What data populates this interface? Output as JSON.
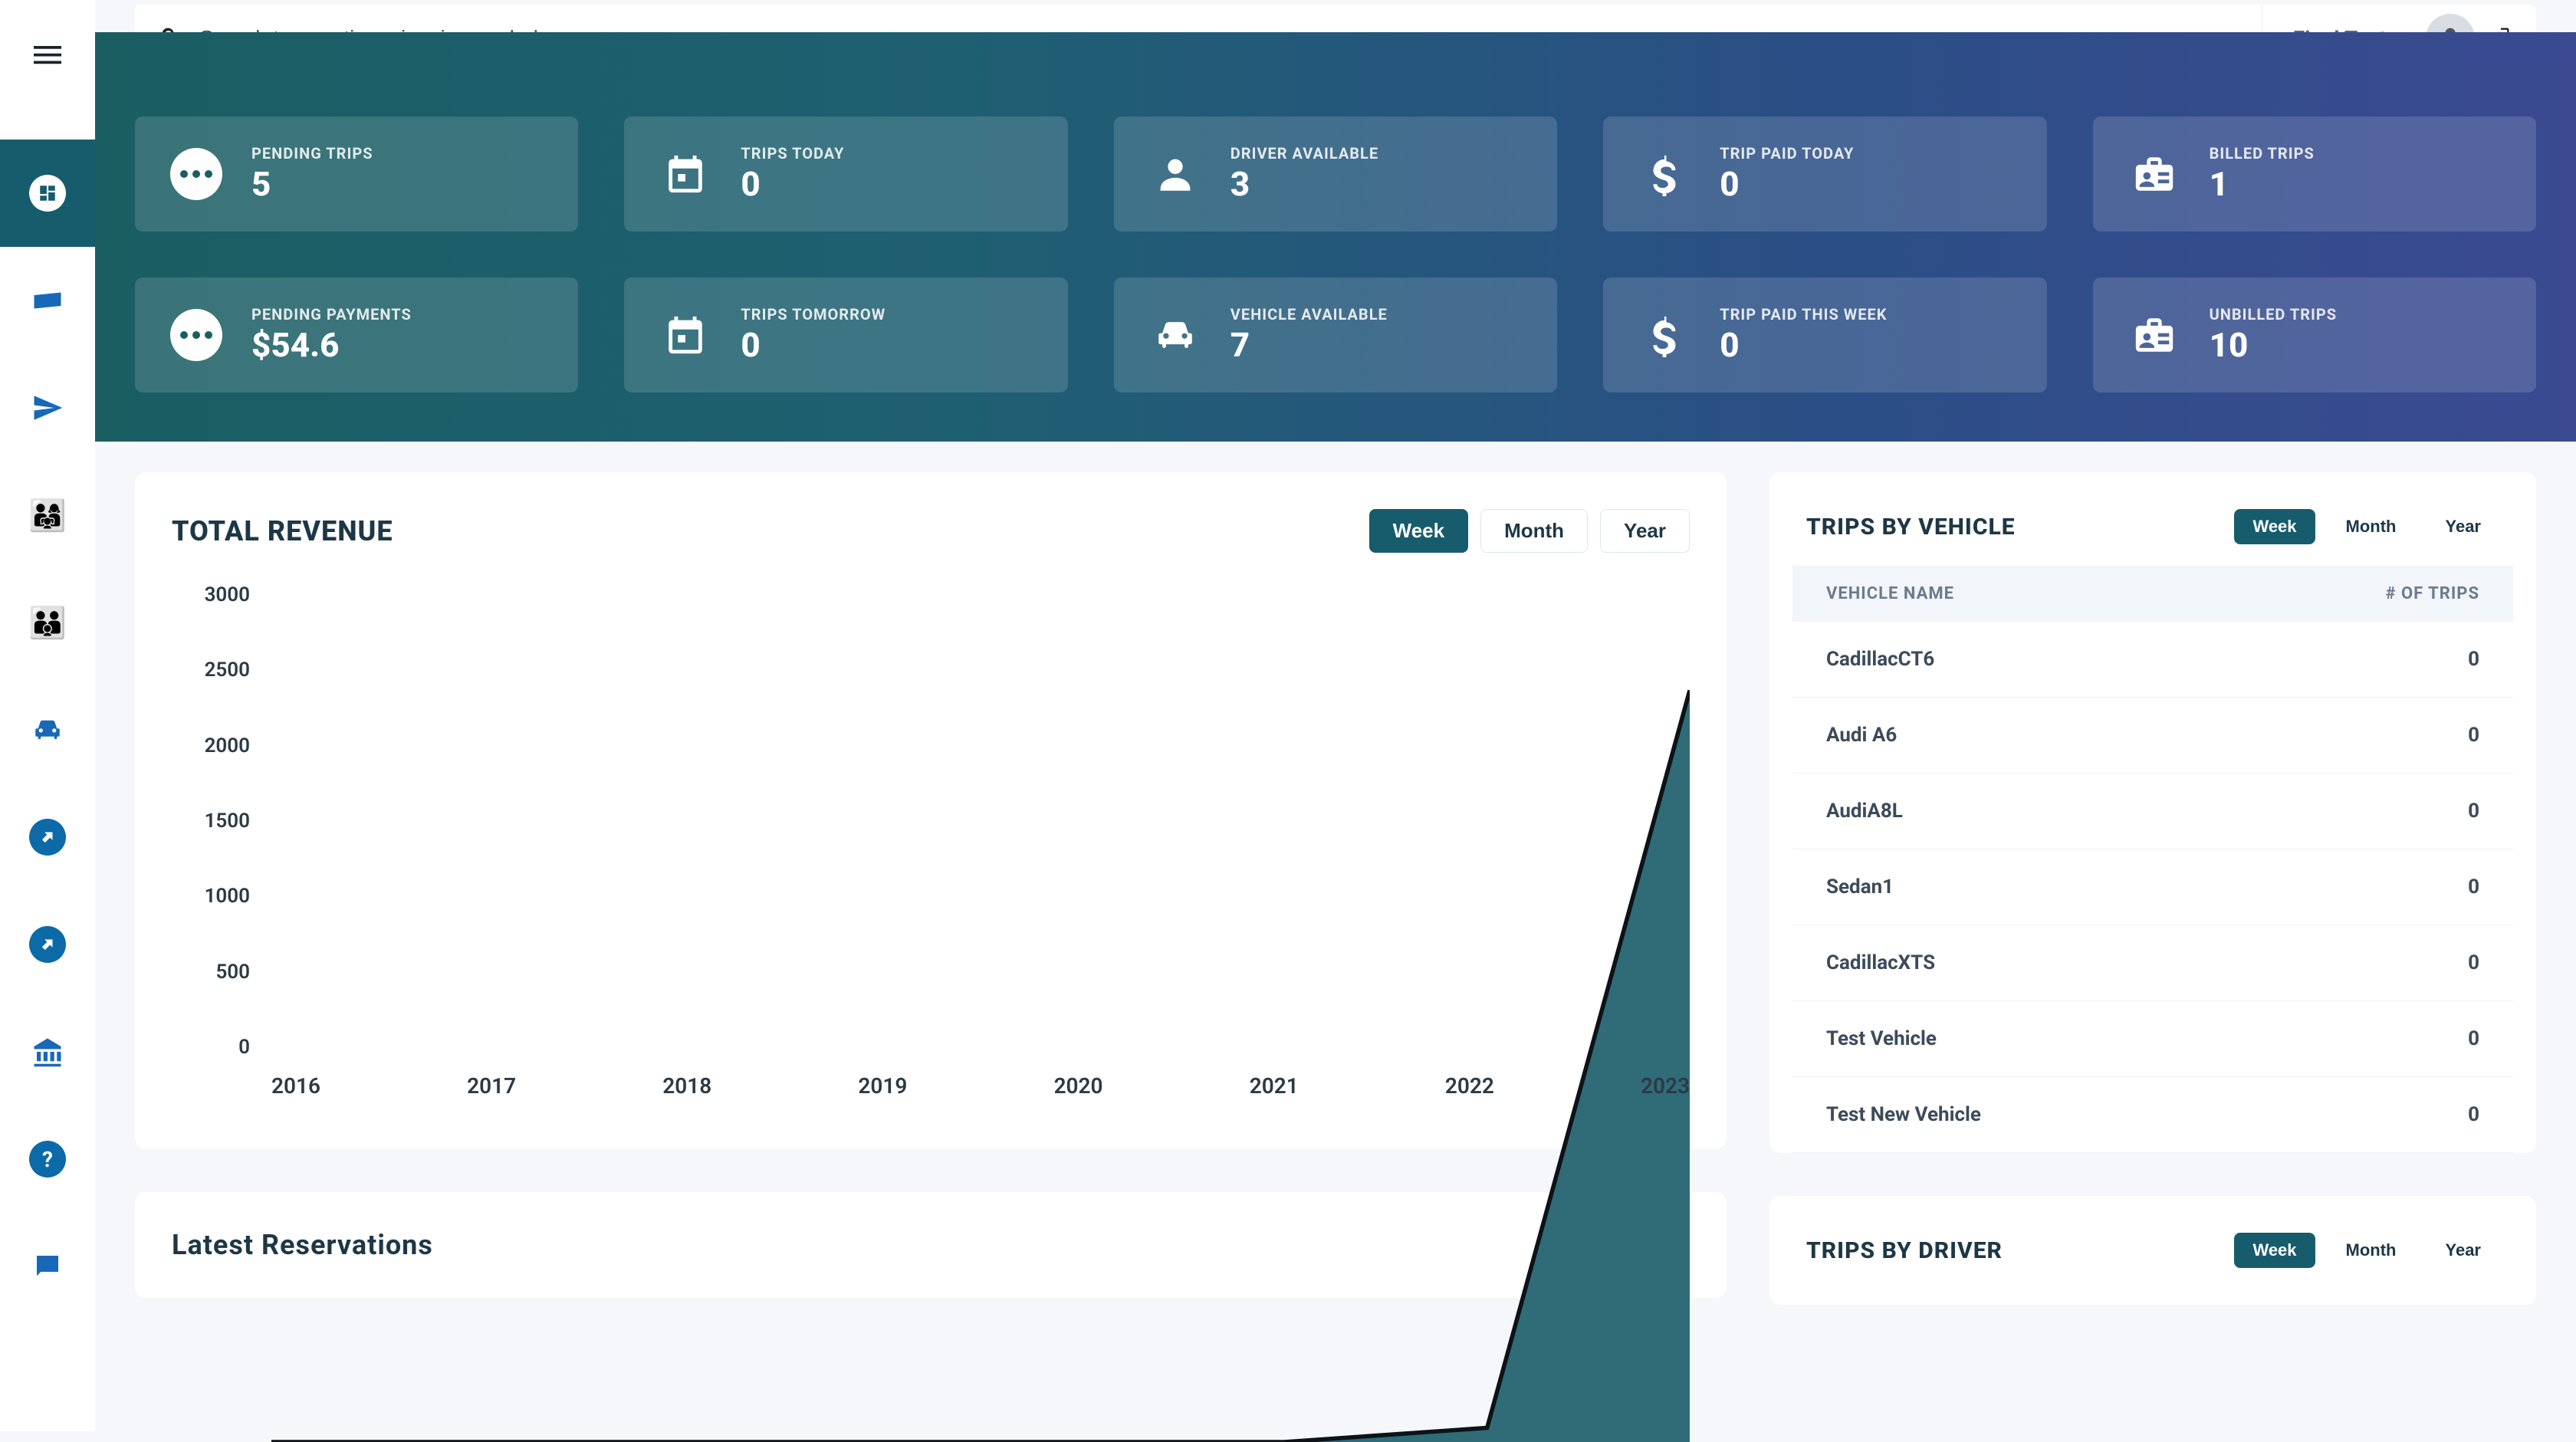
{
  "topbar": {
    "search_placeholder": "Search transections, invoices or help",
    "user_name": "Final Test"
  },
  "stats": [
    {
      "icon": "dots",
      "label": "PENDING TRIPS",
      "value": "5"
    },
    {
      "icon": "calendar",
      "label": "TRIPS TODAY",
      "value": "0"
    },
    {
      "icon": "person",
      "label": "DRIVER AVAILABLE",
      "value": "3"
    },
    {
      "icon": "dollar",
      "label": "TRIP PAID TODAY",
      "value": "0"
    },
    {
      "icon": "badge",
      "label": "BILLED TRIPS",
      "value": "1"
    },
    {
      "icon": "dots",
      "label": "PENDING PAYMENTS",
      "value": "$54.6"
    },
    {
      "icon": "calendar",
      "label": "TRIPS TOMORROW",
      "value": "0"
    },
    {
      "icon": "car",
      "label": "VEHICLE AVAILABLE",
      "value": "7"
    },
    {
      "icon": "dollar",
      "label": "TRIP PAID THIS WEEK",
      "value": "0"
    },
    {
      "icon": "badge",
      "label": "UNBILLED TRIPS",
      "value": "10"
    }
  ],
  "revenue": {
    "title": "TOTAL REVENUE",
    "tabs": {
      "week": "Week",
      "month": "Month",
      "year": "Year"
    }
  },
  "chart_data": {
    "type": "area",
    "title": "TOTAL REVENUE",
    "xlabel": "",
    "ylabel": "",
    "ylim": [
      0,
      3000
    ],
    "yticks": [
      0,
      500,
      1000,
      1500,
      2000,
      2500,
      3000
    ],
    "x": [
      2016,
      2017,
      2018,
      2019,
      2020,
      2021,
      2022,
      2023
    ],
    "values": [
      0,
      0,
      0,
      0,
      0,
      0,
      50,
      2650
    ]
  },
  "trips_by_vehicle": {
    "title": "TRIPS BY VEHICLE",
    "tabs": {
      "week": "Week",
      "month": "Month",
      "year": "Year"
    },
    "headers": {
      "name": "VEHICLE NAME",
      "count": "# OF TRIPS"
    },
    "rows": [
      {
        "name": "CadillacCT6",
        "count": "0"
      },
      {
        "name": "Audi A6",
        "count": "0"
      },
      {
        "name": "AudiA8L",
        "count": "0"
      },
      {
        "name": "Sedan1",
        "count": "0"
      },
      {
        "name": "CadillacXTS",
        "count": "0"
      },
      {
        "name": "Test Vehicle",
        "count": "0"
      },
      {
        "name": "Test New Vehicle",
        "count": "0"
      }
    ]
  },
  "reservations": {
    "title": "Latest Reservations"
  },
  "trips_by_driver": {
    "title": "TRIPS BY DRIVER",
    "tabs": {
      "week": "Week",
      "month": "Month",
      "year": "Year"
    }
  }
}
